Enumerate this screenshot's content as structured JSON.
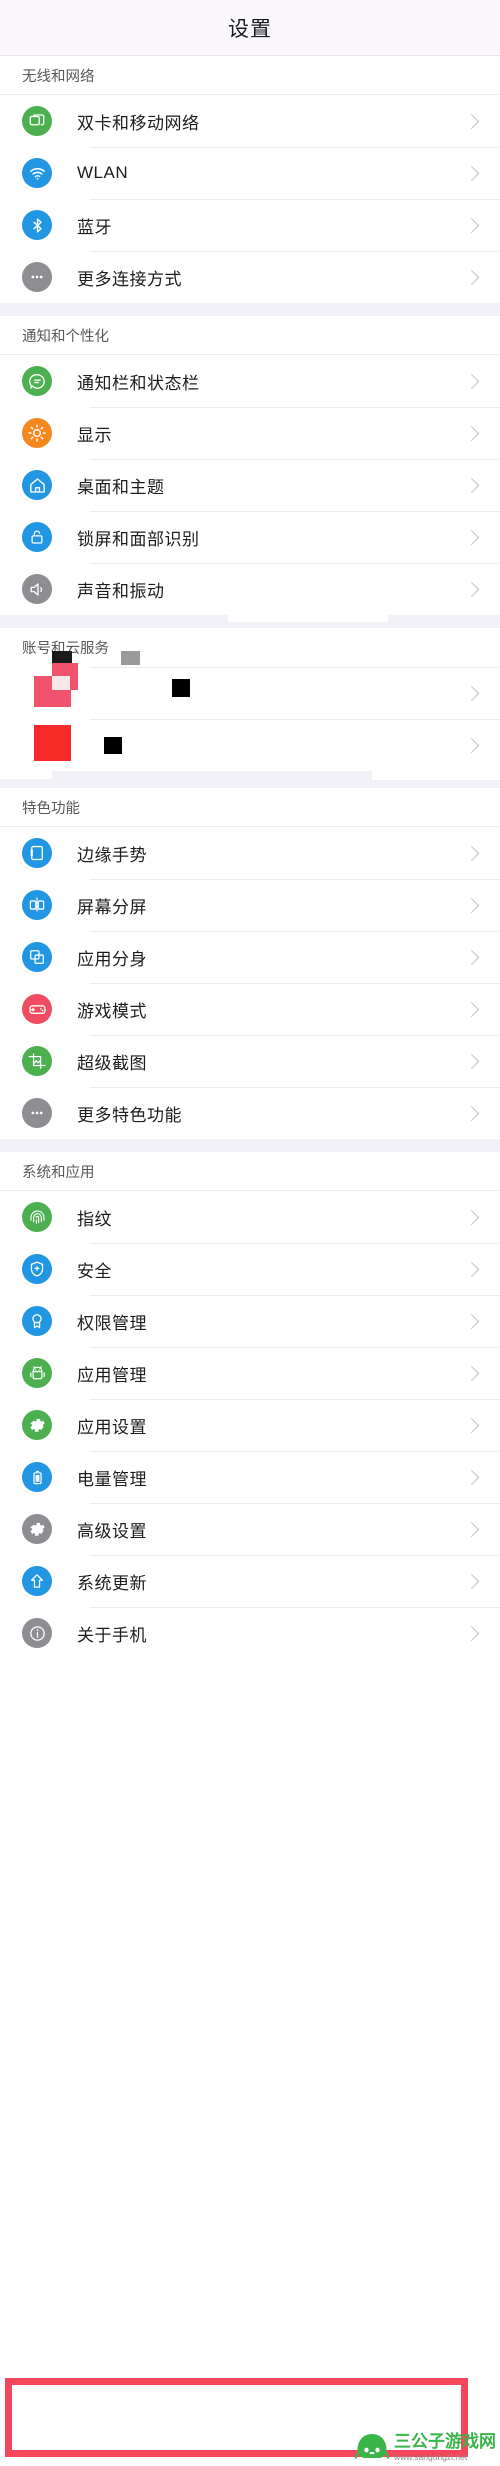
{
  "header": {
    "title": "设置"
  },
  "colors": {
    "band": "#f2f1f7",
    "header_bg": "#fbf8fb",
    "chevron": "#c3c3c7",
    "highlight": "#f5465b",
    "green": "#4cb050",
    "blue": "#2196e3",
    "orange": "#f5871f",
    "gray": "#8d8d92",
    "pink": "#ef4c62",
    "watermark_green": "#3ab54a"
  },
  "sections": [
    {
      "title": "无线和网络",
      "rows": [
        {
          "label": "双卡和移动网络",
          "icon": "sim-card-icon",
          "icon_color": "#4cb050"
        },
        {
          "label": "WLAN",
          "icon": "wifi-icon",
          "icon_color": "#2196e3"
        },
        {
          "label": "蓝牙",
          "icon": "bluetooth-icon",
          "icon_color": "#2196e3"
        },
        {
          "label": "更多连接方式",
          "icon": "more-dots-icon",
          "icon_color": "#8d8d92"
        }
      ]
    },
    {
      "title": "通知和个性化",
      "rows": [
        {
          "label": "通知栏和状态栏",
          "icon": "chat-bubble-icon",
          "icon_color": "#4cb050"
        },
        {
          "label": "显示",
          "icon": "brightness-icon",
          "icon_color": "#f5871f"
        },
        {
          "label": "桌面和主题",
          "icon": "home-icon",
          "icon_color": "#2196e3"
        },
        {
          "label": "锁屏和面部识别",
          "icon": "lock-icon",
          "icon_color": "#2196e3"
        },
        {
          "label": "声音和振动",
          "icon": "speaker-icon",
          "icon_color": "#8d8d92"
        }
      ]
    },
    {
      "title": "账号和云服务",
      "redacted": true,
      "rows": [
        {
          "label": "",
          "icon": "redacted-icon",
          "icon_color": "#ef4c62"
        },
        {
          "label": "",
          "icon": "redacted-icon",
          "icon_color": "#f72a2a"
        }
      ]
    },
    {
      "title": "特色功能",
      "rows": [
        {
          "label": "边缘手势",
          "icon": "edge-gesture-icon",
          "icon_color": "#2196e3"
        },
        {
          "label": "屏幕分屏",
          "icon": "split-screen-icon",
          "icon_color": "#2196e3"
        },
        {
          "label": "应用分身",
          "icon": "app-clone-icon",
          "icon_color": "#2196e3"
        },
        {
          "label": "游戏模式",
          "icon": "gamepad-icon",
          "icon_color": "#ef4c62"
        },
        {
          "label": "超级截图",
          "icon": "screenshot-icon",
          "icon_color": "#4cb050"
        },
        {
          "label": "更多特色功能",
          "icon": "more-dots-icon",
          "icon_color": "#8d8d92"
        }
      ]
    },
    {
      "title": "系统和应用",
      "rows": [
        {
          "label": "指纹",
          "icon": "fingerprint-icon",
          "icon_color": "#4cb050"
        },
        {
          "label": "安全",
          "icon": "shield-icon",
          "icon_color": "#2196e3"
        },
        {
          "label": "权限管理",
          "icon": "permission-badge-icon",
          "icon_color": "#2196e3"
        },
        {
          "label": "应用管理",
          "icon": "android-robot-icon",
          "icon_color": "#4cb050"
        },
        {
          "label": "应用设置",
          "icon": "gear-icon",
          "icon_color": "#4cb050"
        },
        {
          "label": "电量管理",
          "icon": "battery-icon",
          "icon_color": "#2196e3"
        },
        {
          "label": "高级设置",
          "icon": "gear-icon",
          "icon_color": "#8d8d92"
        },
        {
          "label": "系统更新",
          "icon": "up-arrow-icon",
          "icon_color": "#2196e3"
        },
        {
          "label": "关于手机",
          "icon": "info-icon",
          "icon_color": "#8d8d92",
          "highlighted": true
        }
      ]
    }
  ],
  "watermark": {
    "name": "三公子游戏网",
    "url": "www.sangongzi.net"
  }
}
